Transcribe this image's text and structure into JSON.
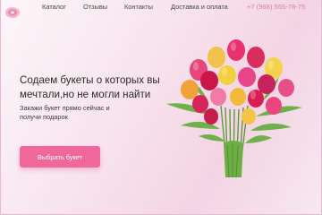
{
  "nav": {
    "items": [
      "Каталог",
      "Отзывы",
      "Контакты",
      "Доставка и оплата"
    ],
    "phone": "+7 (968) 555-78-75"
  },
  "hero": {
    "headline": "Содаем букеты о которых вы мечтали,но не могли найти",
    "subtext": "Закажи букет прямо сейчас и получи подарок",
    "cta_label": "Выбрать букет"
  },
  "colors": {
    "accent": "#f0679c",
    "phone": "#e07aa2",
    "text": "#2b2b2b"
  },
  "icons": {
    "logo": "flower-logo-icon",
    "image": "tulip-bouquet"
  }
}
